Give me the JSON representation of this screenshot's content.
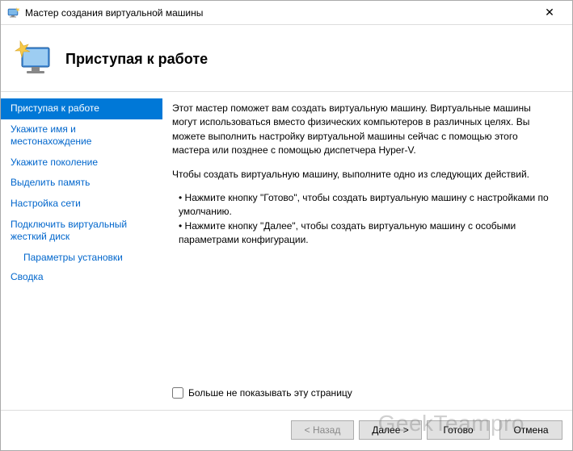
{
  "window": {
    "title": "Мастер создания виртуальной машины"
  },
  "header": {
    "title": "Приступая к работе"
  },
  "sidebar": {
    "items": [
      {
        "label": "Приступая к работе",
        "selected": true
      },
      {
        "label": "Укажите имя и местонахождение"
      },
      {
        "label": "Укажите поколение"
      },
      {
        "label": "Выделить память"
      },
      {
        "label": "Настройка сети"
      },
      {
        "label": "Подключить виртуальный жесткий диск"
      },
      {
        "label": "Параметры установки",
        "sub": true
      },
      {
        "label": "Сводка"
      }
    ]
  },
  "main": {
    "intro": "Этот мастер поможет вам создать виртуальную машину. Виртуальные машины могут использоваться вместо физических компьютеров в различных целях. Вы можете выполнить настройку виртуальной машины сейчас с помощью этого мастера или позднее с помощью диспетчера Hyper-V.",
    "instruction": "Чтобы создать виртуальную машину, выполните одно из следующих действий.",
    "bullet1": "Нажмите кнопку \"Готово\", чтобы создать виртуальную машину с настройками по умолчанию.",
    "bullet2": "Нажмите кнопку \"Далее\", чтобы создать виртуальную машину с особыми параметрами конфигурации.",
    "checkbox_label": "Больше не показывать эту страницу"
  },
  "buttons": {
    "back": "< Назад",
    "next": "Далее >",
    "finish": "Готово",
    "cancel": "Отмена"
  },
  "watermark": "GeekTeampro"
}
